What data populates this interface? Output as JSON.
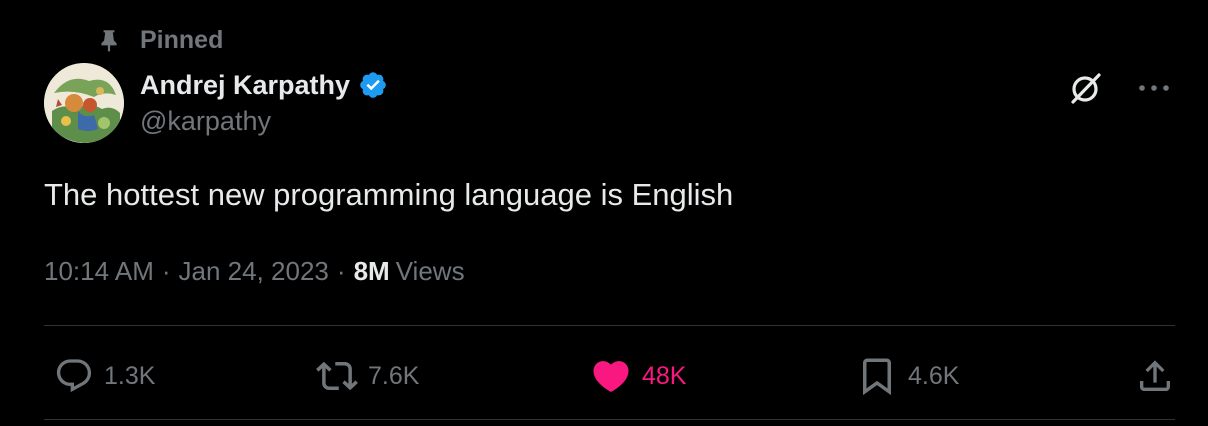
{
  "pinned": {
    "label": "Pinned",
    "icon": "pin-icon"
  },
  "author": {
    "display_name": "Andrej Karpathy",
    "handle": "@karpathy",
    "verified_icon": "verified-badge-icon",
    "verified_color": "#1d9bf0"
  },
  "top_actions": {
    "grok_icon": "grok-icon",
    "more_icon": "more-horizontal-icon"
  },
  "tweet": {
    "text": "The hottest new programming language is English",
    "time": "10:14 AM",
    "separator": "·",
    "date": "Jan 24, 2023",
    "views_count": "8M",
    "views_label": "Views"
  },
  "actions": {
    "reply": {
      "icon": "reply-icon",
      "count": "1.3K"
    },
    "retweet": {
      "icon": "retweet-icon",
      "count": "7.6K"
    },
    "like": {
      "icon": "heart-filled-icon",
      "count": "48K",
      "color": "#f91880"
    },
    "bookmark": {
      "icon": "bookmark-icon",
      "count": "4.6K"
    },
    "share": {
      "icon": "share-icon"
    }
  },
  "colors": {
    "background": "#000000",
    "text_primary": "#e7e9ea",
    "text_secondary": "#71767b",
    "divider": "#2f3336",
    "like": "#f91880",
    "verified": "#1d9bf0"
  }
}
